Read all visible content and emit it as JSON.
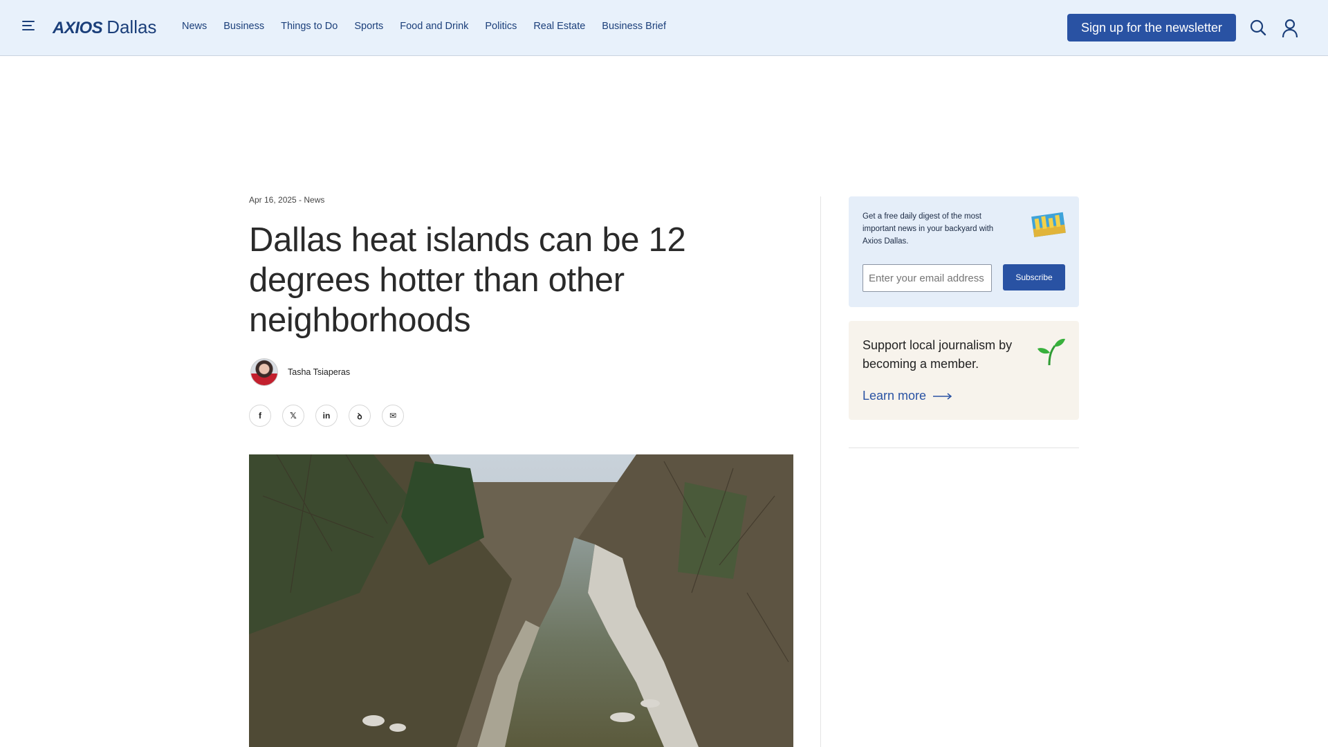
{
  "header": {
    "logo_brand": "AXIOS",
    "logo_city": "Dallas",
    "nav": [
      "News",
      "Business",
      "Things to Do",
      "Sports",
      "Food and Drink",
      "Politics",
      "Real Estate",
      "Business Brief"
    ],
    "signup_label": "Sign up for the newsletter",
    "icons": [
      "menu-icon",
      "search-icon",
      "user-icon"
    ]
  },
  "article": {
    "meta": "Apr 16, 2025 - News",
    "title": "Dallas heat islands can be 12 degrees hotter than other neighborhoods",
    "author": "Tasha Tsiaperas",
    "share": [
      {
        "name": "facebook-icon",
        "glyph": "f"
      },
      {
        "name": "x-icon",
        "glyph": "𝕏"
      },
      {
        "name": "linkedin-icon",
        "glyph": "in"
      },
      {
        "name": "threads-icon",
        "glyph": "ꝺ"
      },
      {
        "name": "email-icon",
        "glyph": "✉"
      }
    ]
  },
  "sidebar": {
    "promo_text": "Get a free daily digest of the most important news in your backyard with Axios Dallas.",
    "email_placeholder": "Enter your email address",
    "subscribe_label": "Subscribe",
    "member_text": "Support local journalism by becoming a member.",
    "learn_more_label": "Learn more"
  },
  "colors": {
    "header_bg": "#e8f1fb",
    "accent": "#2952a3",
    "brand": "#1b3f7a",
    "promo_bg": "#e5eef9",
    "member_bg": "#f7f3ec"
  }
}
